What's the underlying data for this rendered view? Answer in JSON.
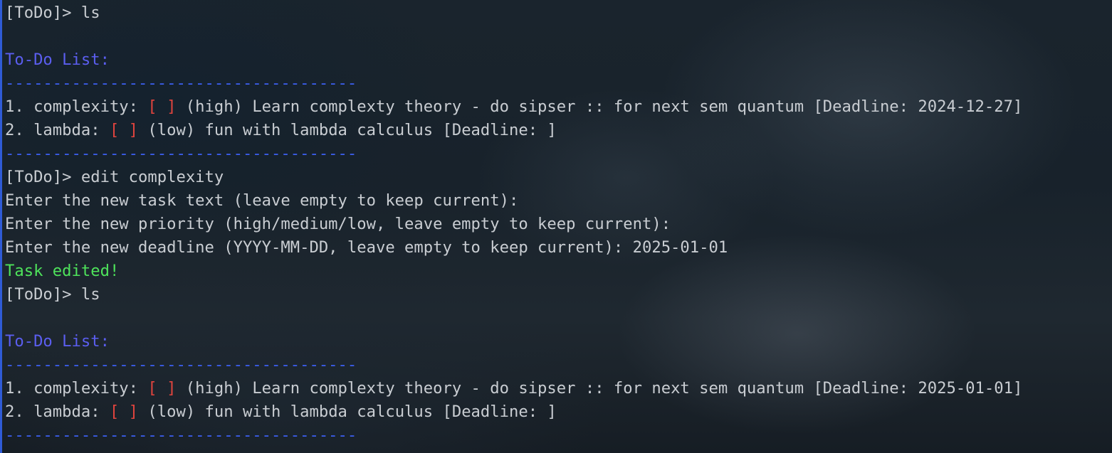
{
  "terminal": {
    "colors": {
      "prompt_text": "#c9cdd2",
      "heading": "#5b5ef0",
      "checkbox": "#e0443e",
      "success": "#4ee35b",
      "separator": "#3c5ff0"
    },
    "lines": [
      {
        "prompt": "[ToDo]> ",
        "cmd": "ls"
      },
      {
        "heading": "To-Do List:"
      },
      {
        "separator": "-------------------------------------"
      },
      {
        "num": "1. ",
        "tag": "complexity: ",
        "checkbox": "[ ]",
        "rest": " (high) Learn complexty theory - do sipser :: for next sem quantum [Deadline: 2024-12-27]"
      },
      {
        "num": "2. ",
        "tag": "lambda: ",
        "checkbox": "[ ]",
        "rest": " (low) fun with lambda calculus [Deadline: ]"
      },
      {
        "separator": "-------------------------------------"
      },
      {
        "prompt": "[ToDo]> ",
        "cmd": "edit complexity"
      },
      {
        "text": "Enter the new task text (leave empty to keep current):"
      },
      {
        "text": "Enter the new priority (high/medium/low, leave empty to keep current):"
      },
      {
        "text": "Enter the new deadline (YYYY-MM-DD, leave empty to keep current): 2025-01-01"
      },
      {
        "success": "Task edited!"
      },
      {
        "prompt": "[ToDo]> ",
        "cmd": "ls"
      },
      {
        "heading": "To-Do List:"
      },
      {
        "separator": "-------------------------------------"
      },
      {
        "num": "1. ",
        "tag": "complexity: ",
        "checkbox": "[ ]",
        "rest": " (high) Learn complexty theory - do sipser :: for next sem quantum [Deadline: 2025-01-01]"
      },
      {
        "num": "2. ",
        "tag": "lambda: ",
        "checkbox": "[ ]",
        "rest": " (low) fun with lambda calculus [Deadline: ]"
      },
      {
        "separator": "-------------------------------------"
      }
    ]
  }
}
